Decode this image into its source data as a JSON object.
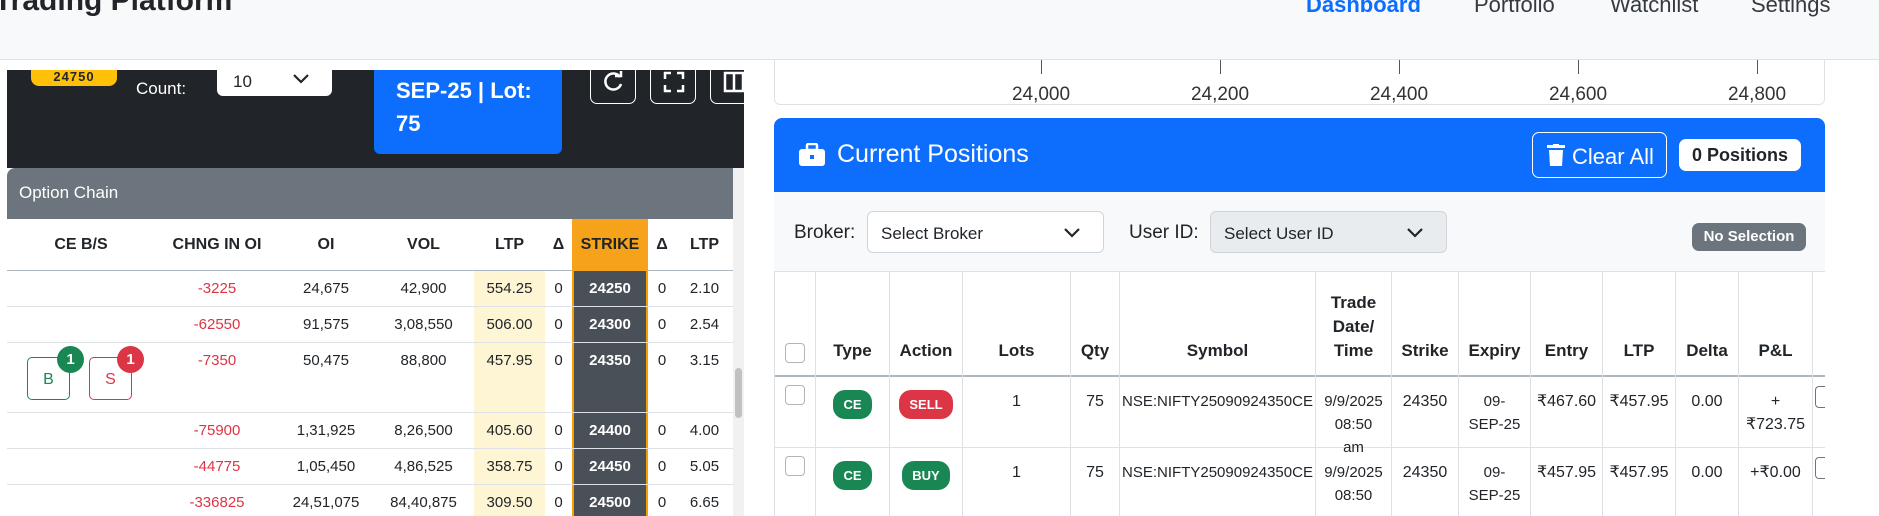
{
  "navbar": {
    "brand": "Trading Platform",
    "links": [
      "Dashboard",
      "Portfolio",
      "Watchlist",
      "Settings"
    ],
    "active": "Dashboard"
  },
  "toolbar": {
    "spot": "24750",
    "count_label": "Count:",
    "count_value": "10",
    "expiry_line1": "SEP-25 | Lot:",
    "expiry_line2": "75"
  },
  "option_chain": {
    "title": "Option Chain",
    "headers": [
      "CE B/S",
      "CHNG IN OI",
      "OI",
      "VOL",
      "LTP",
      "Δ",
      "STRIKE",
      "Δ",
      "LTP"
    ],
    "rows": [
      {
        "chng": "-3225",
        "oi": "24,675",
        "vol": "42,900",
        "ltp": "554.25",
        "d1": "0",
        "strike": "24250",
        "d2": "0",
        "pe_ltp": "2.10"
      },
      {
        "chng": "-62550",
        "oi": "91,575",
        "vol": "3,08,550",
        "ltp": "506.00",
        "d1": "0",
        "strike": "24300",
        "d2": "0",
        "pe_ltp": "2.54"
      },
      {
        "chng": "-7350",
        "oi": "50,475",
        "vol": "88,800",
        "ltp": "457.95",
        "d1": "0",
        "strike": "24350",
        "d2": "0",
        "pe_ltp": "3.15"
      },
      {
        "chng": "-75900",
        "oi": "1,31,925",
        "vol": "8,26,500",
        "ltp": "405.60",
        "d1": "0",
        "strike": "24400",
        "d2": "0",
        "pe_ltp": "4.00"
      },
      {
        "chng": "-44775",
        "oi": "1,05,450",
        "vol": "4,86,525",
        "ltp": "358.75",
        "d1": "0",
        "strike": "24450",
        "d2": "0",
        "pe_ltp": "5.05"
      },
      {
        "chng": "-336825",
        "oi": "24,51,075",
        "vol": "84,40,875",
        "ltp": "309.50",
        "d1": "0",
        "strike": "24500",
        "d2": "0",
        "pe_ltp": "6.65"
      }
    ],
    "buy_label": "B",
    "sell_label": "S",
    "buy_count": "1",
    "sell_count": "1"
  },
  "chart_axis": {
    "ticks": [
      "24,000",
      "24,200",
      "24,400",
      "24,600",
      "24,800"
    ]
  },
  "positions": {
    "title": "Current Positions",
    "clear_label": "Clear All",
    "count_label": "0 Positions",
    "broker_label": "Broker:",
    "broker_placeholder": "Select Broker",
    "user_label": "User ID:",
    "user_placeholder": "Select User ID",
    "selection_badge": "No Selection",
    "headers": [
      "",
      "Type",
      "Action",
      "Lots",
      "Qty",
      "Symbol",
      "Trade Date/ Time",
      "Strike",
      "Expiry",
      "Entry",
      "LTP",
      "Delta",
      "P&L"
    ],
    "rows": [
      {
        "type": "CE",
        "action": "SELL",
        "lots": "1",
        "qty": "75",
        "symbol": "NSE:NIFTY25090924350CE",
        "date": "9/9/2025",
        "time": "08:50",
        "ampm": "am",
        "strike": "24350",
        "expiry1": "09-",
        "expiry2": "SEP-25",
        "entry": "₹467.60",
        "ltp": "₹457.95",
        "delta": "0.00",
        "pnl1": "+",
        "pnl2": "₹723.75"
      },
      {
        "type": "CE",
        "action": "BUY",
        "lots": "1",
        "qty": "75",
        "symbol": "NSE:NIFTY25090924350CE",
        "date": "9/9/2025",
        "time": "08:50",
        "ampm": "",
        "strike": "24350",
        "expiry1": "09-",
        "expiry2": "SEP-25",
        "entry": "₹457.95",
        "ltp": "₹457.95",
        "delta": "0.00",
        "pnl1": "+₹0.00",
        "pnl2": ""
      }
    ]
  }
}
